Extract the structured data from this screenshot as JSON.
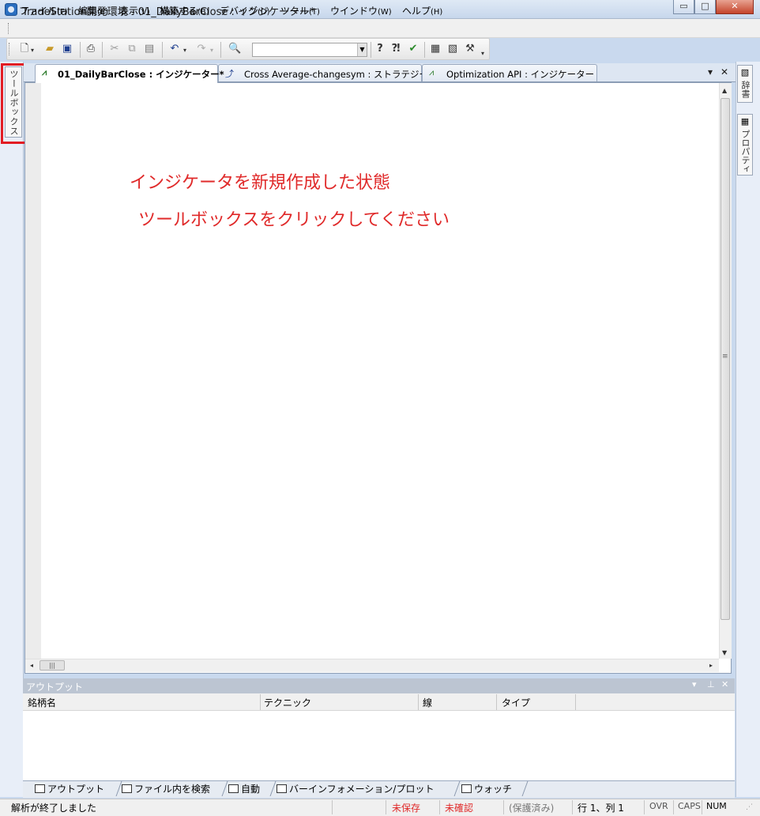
{
  "window": {
    "title": "TradeStation開発環境 - 01_DailyBarClose : インジケーター*",
    "controls": {
      "minimize": "▭",
      "maximize": "□",
      "close": "✕"
    }
  },
  "menu": [
    {
      "label": "ファイル",
      "accel": "(F)"
    },
    {
      "label": "編集",
      "accel": "(E)"
    },
    {
      "label": "表示",
      "accel": "(V)"
    },
    {
      "label": "構築する",
      "accel": "(B)"
    },
    {
      "label": "デバッグ",
      "accel": "(D)"
    },
    {
      "label": "ツール",
      "accel": "(T)"
    },
    {
      "label": "ウインドウ",
      "accel": "(W)"
    },
    {
      "label": "ヘルプ",
      "accel": "(H)"
    }
  ],
  "toolbar": {
    "icons": [
      "new-file-icon",
      "open-folder-icon",
      "save-icon",
      "print-icon",
      "cut-icon",
      "copy-icon",
      "paste-icon",
      "undo-icon",
      "redo-icon",
      "find-icon",
      "help-icon",
      "context-help-icon",
      "verify-icon",
      "properties-icon",
      "dictionary-icon",
      "build-tools-icon"
    ],
    "symbol_value": ""
  },
  "left_panel": {
    "toolbox_label": "ツールボックス"
  },
  "right_panel": {
    "dictionary_label": "辞書",
    "properties_label": "プロパティ"
  },
  "tabs": [
    {
      "label": "01_DailyBarClose : インジケーター*",
      "active": true,
      "icon": "indicator-icon"
    },
    {
      "label": "Cross Average-changesym : ストラテジー",
      "active": false,
      "icon": "strategy-icon"
    },
    {
      "label": "Optimization API : インジケーター",
      "active": false,
      "icon": "indicator-icon"
    }
  ],
  "tab_controls": {
    "menu": "▾",
    "close": "✕"
  },
  "editor": {
    "annotation_line1": "インジケータを新規作成した状態",
    "annotation_line2": "ツールボックスをクリックしてください",
    "annotation_color": "#e02a2a"
  },
  "output": {
    "title": "アウトプット",
    "controls": {
      "menu": "▾",
      "pin": "⊥",
      "close": "✕"
    },
    "columns": [
      "銘柄名",
      "テクニック",
      "線",
      "タイプ"
    ],
    "tabs": [
      "アウトプット",
      "ファイル内を検索",
      "自動",
      "バーインフォメーション/プロット",
      "ウォッチ"
    ]
  },
  "status": {
    "message": "解析が終了しました",
    "unsaved": "未保存",
    "unverified": "未確認",
    "protected": "(保護済み)",
    "position": "行 1、列 1",
    "ovr": "OVR",
    "caps": "CAPS",
    "num": "NUM",
    "alert_color": "#e02a2a"
  }
}
